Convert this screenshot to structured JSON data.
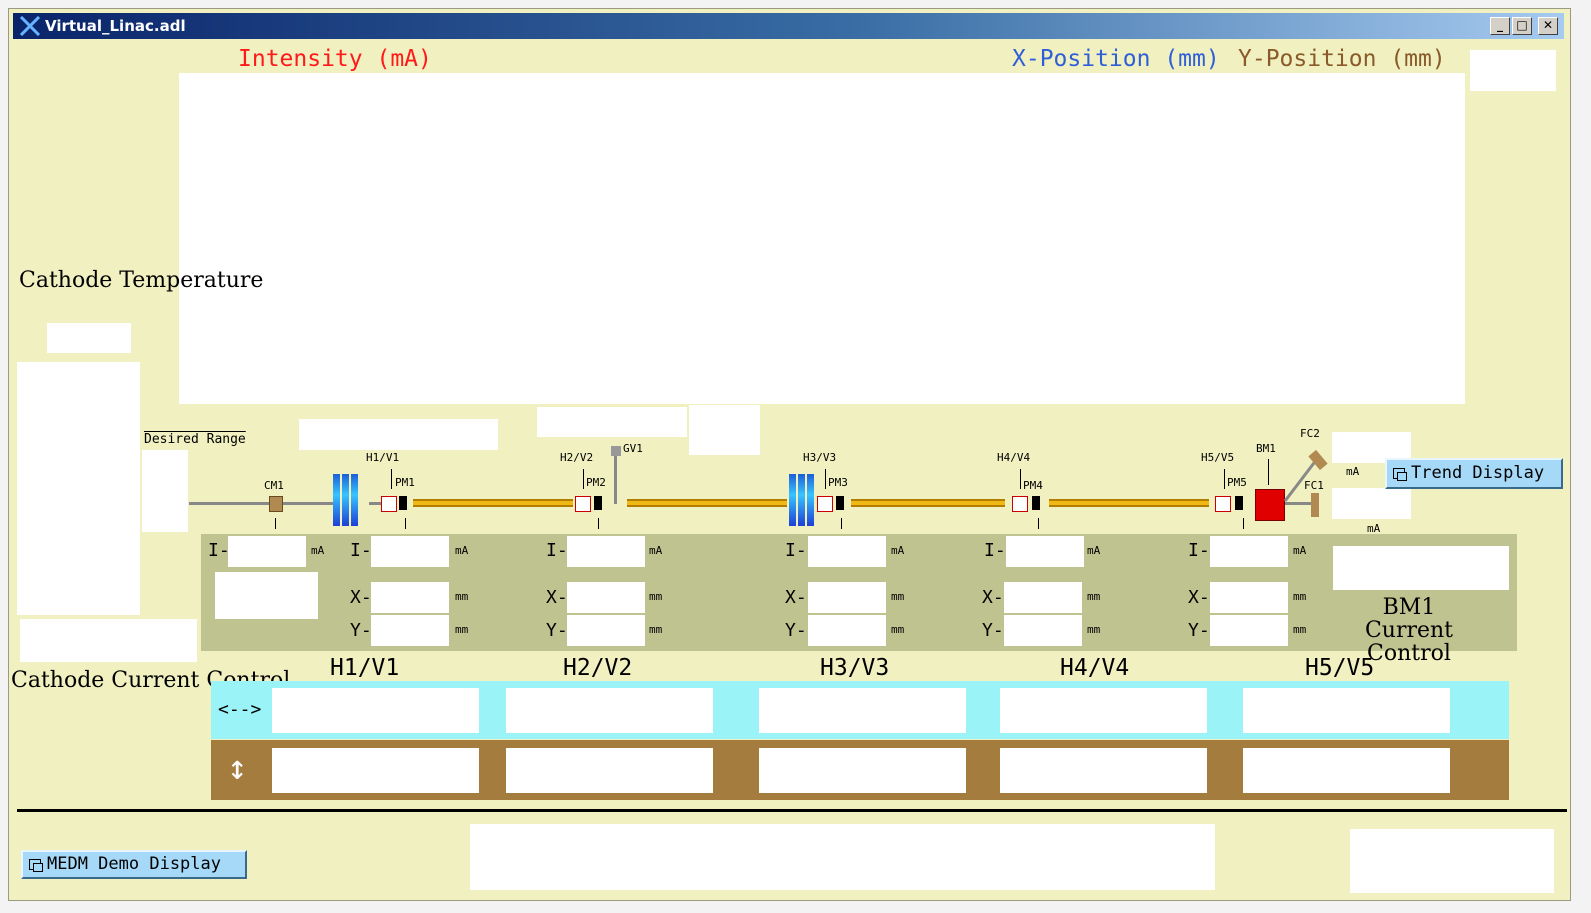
{
  "window": {
    "title": "Virtual_Linac.adl"
  },
  "plot": {
    "intensity_label": "Intensity (mA)",
    "xpos_label": "X-Position (mm)",
    "ypos_label": "Y-Position (mm)",
    "colors": {
      "intensity": "#ff0000",
      "xpos": "#2f5fd8",
      "ypos": "#8a5a2a"
    }
  },
  "cathode": {
    "temperature_label": "Cathode Temperature",
    "desired_range_label": "Desired Range",
    "current_control_label": "Cathode Current Control"
  },
  "beamline": {
    "labels": {
      "cm1": "CM1",
      "h1v1": "H1/V1",
      "pm1": "PM1",
      "h2v2": "H2/V2",
      "pm2": "PM2",
      "gv1": "GV1",
      "h3v3": "H3/V3",
      "pm3": "PM3",
      "h4v4": "H4/V4",
      "pm4": "PM4",
      "h5v5": "H5/V5",
      "pm5": "PM5",
      "bm1": "BM1",
      "fc2": "FC2",
      "fc1": "FC1"
    },
    "fc_units": {
      "fc2": "mA",
      "fc1": "mA"
    }
  },
  "readouts": {
    "i_prefix": "I-",
    "x_prefix": "X-",
    "y_prefix": "Y-",
    "unit_ma": "mA",
    "unit_mm": "mm"
  },
  "bm1_current_control": "BM1 Current Control",
  "steering": {
    "headers": [
      "H1/V1",
      "H2/V2",
      "H3/V3",
      "H4/V4",
      "H5/V5"
    ],
    "horizontal_symbol": "<-->",
    "vertical_symbol": "↕"
  },
  "buttons": {
    "trend_display": "Trend Display",
    "medm_demo": "MEDM Demo Display"
  }
}
